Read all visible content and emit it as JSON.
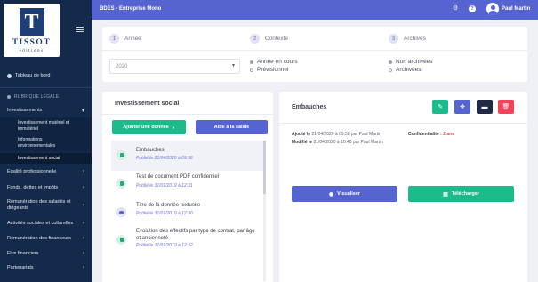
{
  "logo": {
    "mark": "T",
    "name": "TISSOT",
    "sub": "éditions"
  },
  "topbar": {
    "title": "BDES - Entreprise Mono",
    "user": "Paul Martin"
  },
  "sidebar": {
    "dashboard": "Tableau de bord",
    "section": "RUBRIQUE LÉGALE",
    "investissements": "Investissements",
    "sub1": "Investissement matériel et immatériel",
    "sub2": "Informations environnementales",
    "sub3": "Investissement social",
    "items": [
      "Egalité professionnelle",
      "Fonds, dettes et impôts",
      "Rémunération des salariés et dirigeants",
      "Activités sociales et culturelles",
      "Rémunération des financeurs",
      "Flux financiers",
      "Partenariats"
    ]
  },
  "steps": [
    {
      "num": "1",
      "label": "Année"
    },
    {
      "num": "2",
      "label": "Contexte"
    },
    {
      "num": "3",
      "label": "Archives"
    }
  ],
  "filters": {
    "year": "2020",
    "r1": "Année en cours",
    "r2": "Prévisionnel",
    "r3": "Non archivées",
    "r4": "Archivées"
  },
  "left_panel": {
    "title": "Investissement social",
    "add_btn": "Ajouter une donnée",
    "help_btn": "Aide à la saisie",
    "items": [
      {
        "title": "Embauches",
        "date": "Publié le 21/04/2020 à 09:58"
      },
      {
        "title": "Test de document PDF confidentiel",
        "date": "Publié le 31/01/2019 à 12:31"
      },
      {
        "title": "Titre de la donnée textuelle",
        "date": "Publié le 31/01/2019 à 12:30"
      },
      {
        "title": "Evolution des effectifs par type de contrat, par âge et ancienneté",
        "date": "Publié le 31/01/2019 à 12:32"
      }
    ]
  },
  "right_panel": {
    "title": "Embauches",
    "added_label": "Ajouté le",
    "added_value": "21/04/2020 à 09:58 par Paul Martin",
    "modified_label": "Modifié le",
    "modified_value": "21/04/2020 à 10:48 par Paul Martin",
    "conf_label": "Confidentialité :",
    "conf_value": "2 ans",
    "view_btn": "Visualiser",
    "download_btn": "Télécharger"
  },
  "colors": {
    "primary": "#5664d2",
    "success": "#1cbb8c",
    "dark": "#212a45",
    "danger": "#f5435b",
    "sidebar": "#132a4a"
  }
}
